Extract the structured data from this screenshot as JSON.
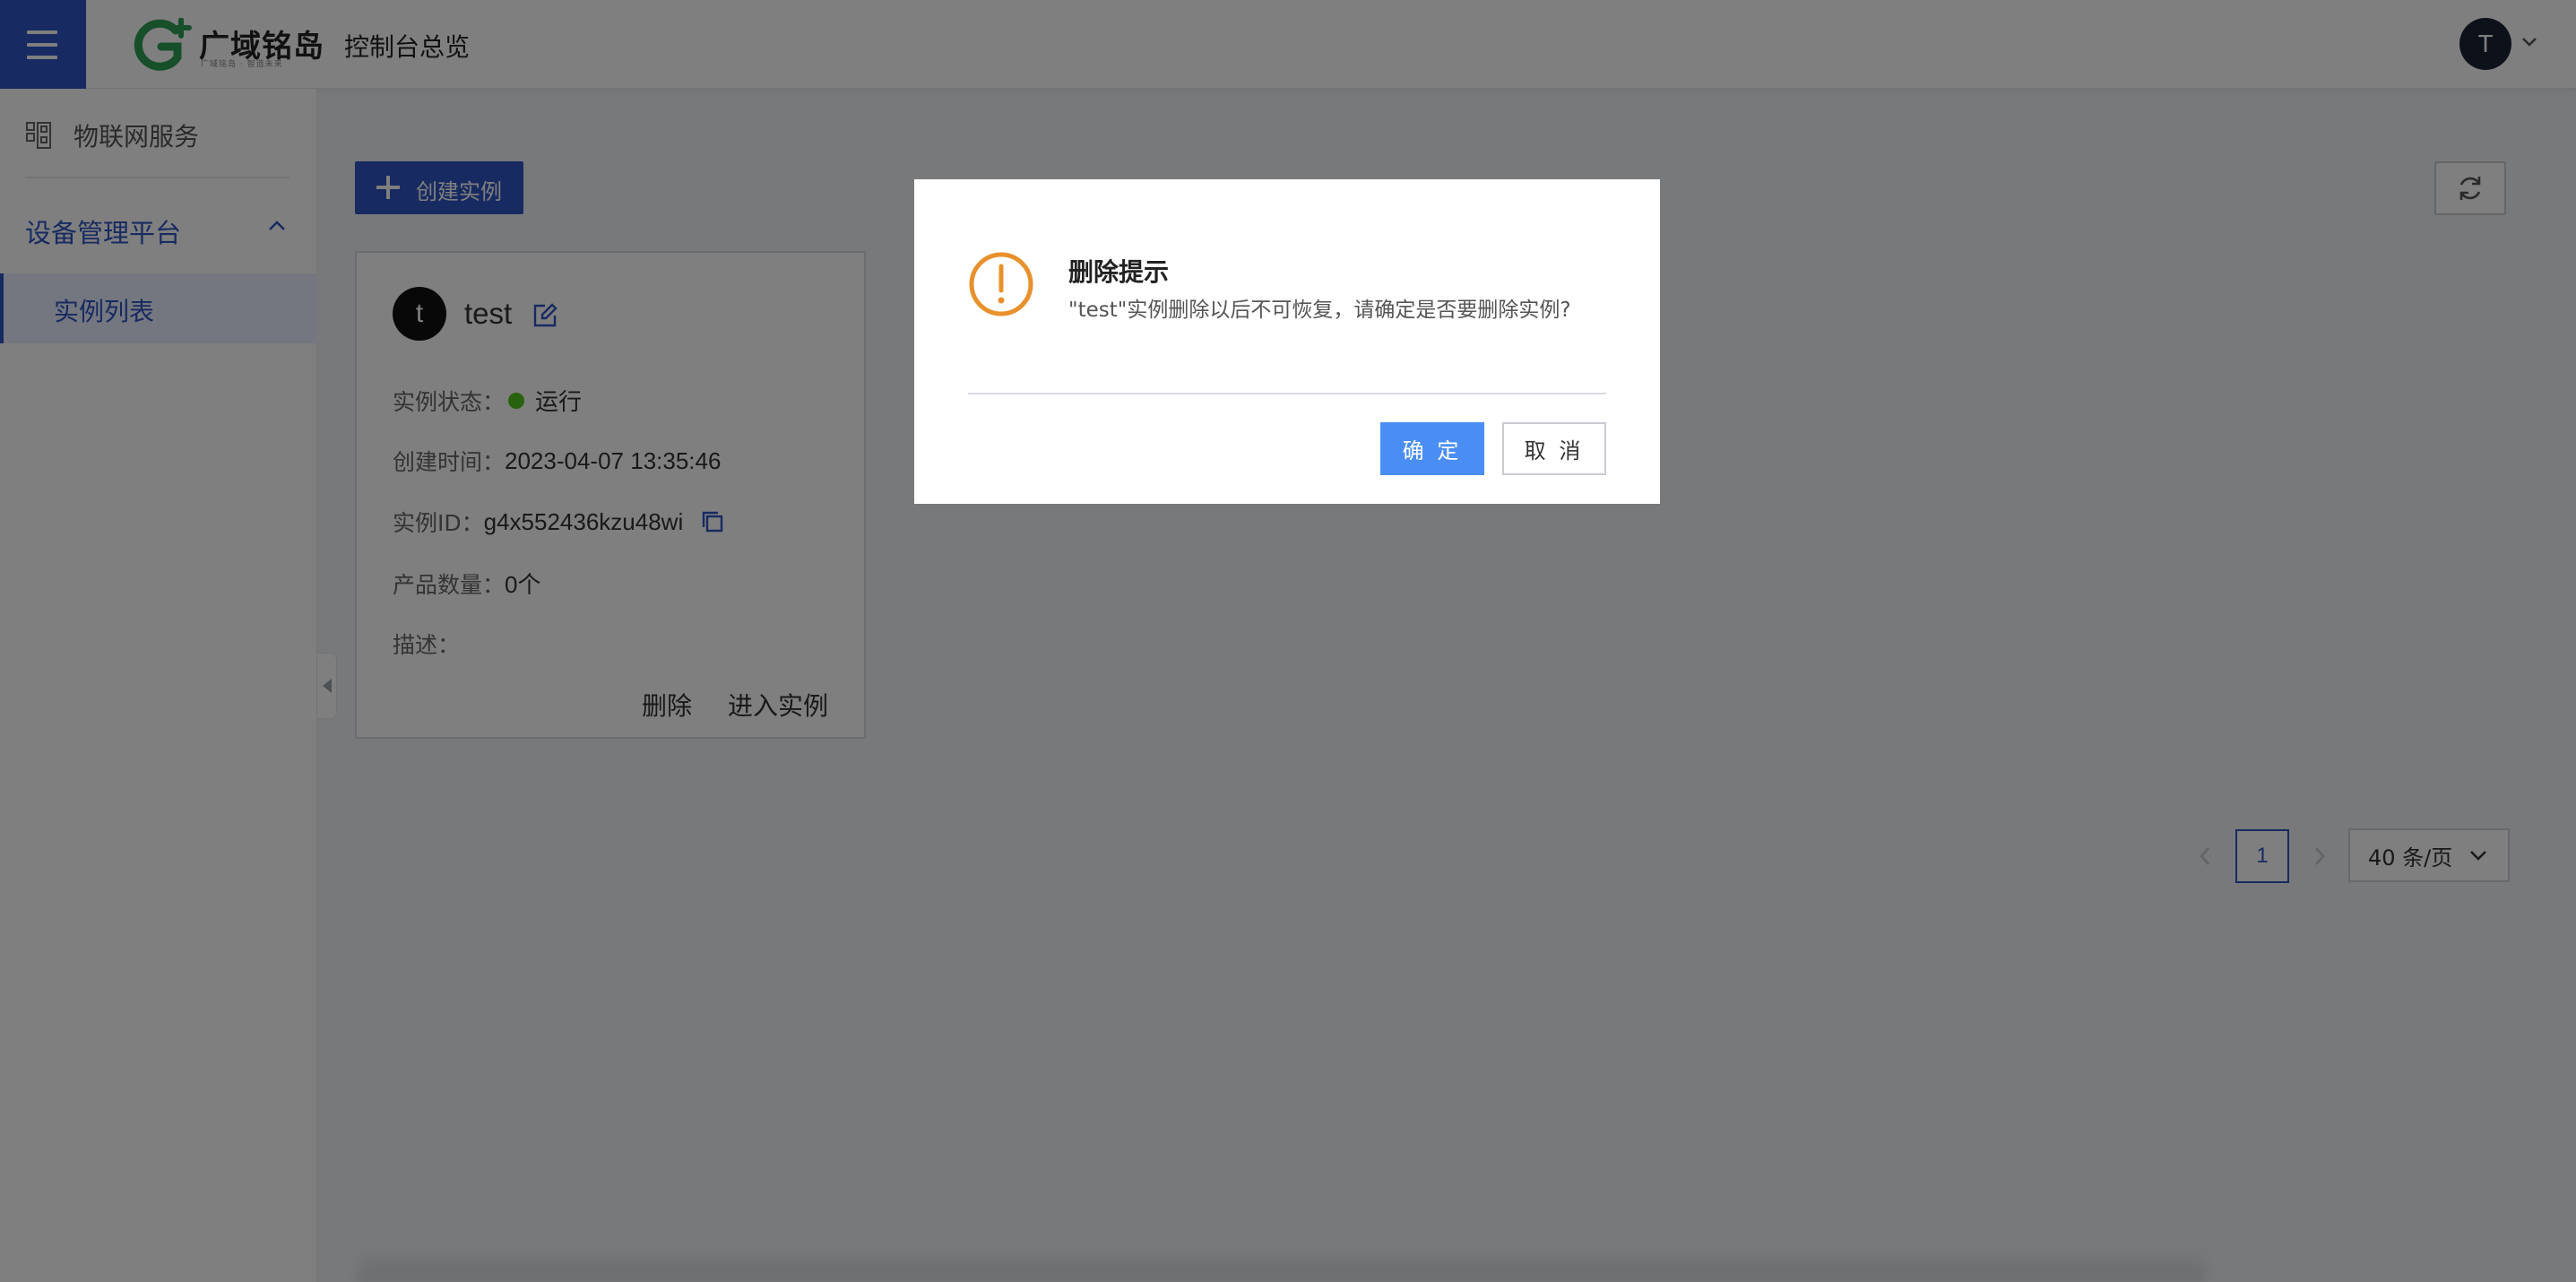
{
  "header": {
    "logo_text": "广域铭岛",
    "logo_tagline": "广域铭岛 · 智造未来",
    "title": "控制台总览",
    "user_initial": "T"
  },
  "sidebar": {
    "iot_service": "物联网服务",
    "platform": "设备管理平台",
    "active_item": "实例列表"
  },
  "toolbar": {
    "create_label": "创建实例"
  },
  "instance_card": {
    "avatar_initial": "t",
    "name": "test",
    "status_label": "实例状态：",
    "status_value": "运行",
    "status_color": "#52c41a",
    "created_label": "创建时间：",
    "created_value": "2023-04-07 13:35:46",
    "id_label": "实例ID：",
    "id_value": "g4x552436kzu48wi",
    "products_label": "产品数量：",
    "products_value": "0个",
    "desc_label": "描述：",
    "delete_label": "删除",
    "enter_label": "进入实例"
  },
  "pagination": {
    "current_page": "1",
    "page_size": "40 条/页"
  },
  "modal": {
    "title": "删除提示",
    "message": "\"test\"实例删除以后不可恢复，请确定是否要删除实例?",
    "confirm_label": "确 定",
    "cancel_label": "取 消",
    "warning_color": "#e8912c",
    "confirm_color": "#4a8ef3"
  },
  "colors": {
    "brand": "#2f54c2",
    "logo_green": "#2e9e57"
  }
}
